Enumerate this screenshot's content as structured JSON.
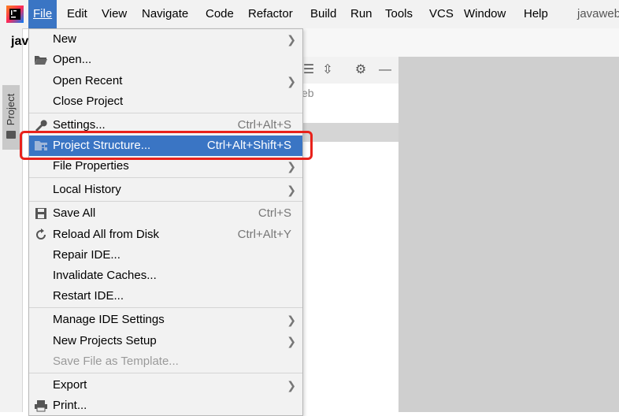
{
  "menubar": {
    "items": [
      "File",
      "Edit",
      "View",
      "Navigate",
      "Code",
      "Refactor",
      "Build",
      "Run",
      "Tools",
      "VCS",
      "Window",
      "Help"
    ],
    "project": "javaweb"
  },
  "editor": {
    "tab_label": "jav",
    "tree_text": "eb"
  },
  "sidebar": {
    "project_tab": "Project"
  },
  "file_menu": {
    "new": "New",
    "open": "Open...",
    "open_recent": "Open Recent",
    "close_project": "Close Project",
    "settings": "Settings...",
    "settings_sc": "Ctrl+Alt+S",
    "project_structure": "Project Structure...",
    "project_structure_sc": "Ctrl+Alt+Shift+S",
    "file_properties": "File Properties",
    "local_history": "Local History",
    "save_all": "Save All",
    "save_all_sc": "Ctrl+S",
    "reload": "Reload All from Disk",
    "reload_sc": "Ctrl+Alt+Y",
    "repair_ide": "Repair IDE...",
    "invalidate": "Invalidate Caches...",
    "restart": "Restart IDE...",
    "manage_settings": "Manage IDE Settings",
    "new_projects_setup": "New Projects Setup",
    "save_as_template": "Save File as Template...",
    "export": "Export",
    "print": "Print..."
  },
  "colors": {
    "selection": "#3a75c4",
    "highlight_box": "#e8221b"
  }
}
